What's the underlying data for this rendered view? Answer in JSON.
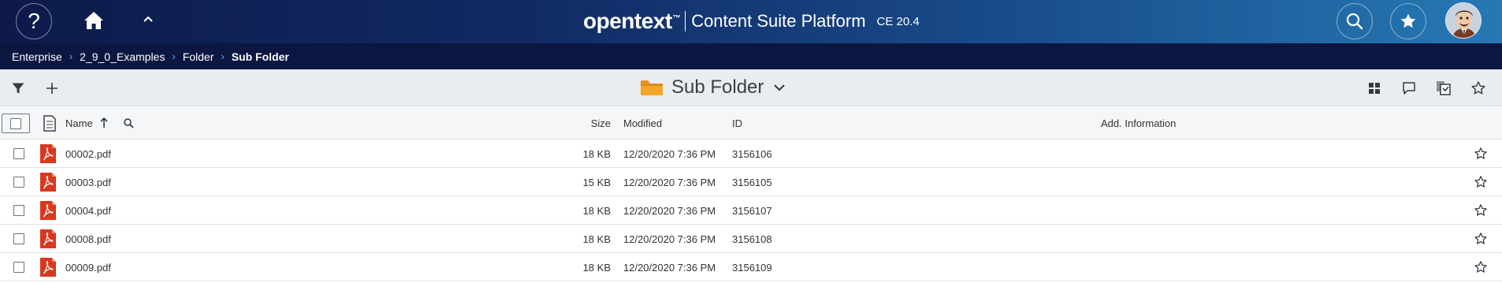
{
  "header": {
    "brand_logo": "opentext",
    "brand_tm": "™",
    "product_name": "Content Suite Platform",
    "version": "CE 20.4",
    "help_glyph": "?",
    "icons": [
      "help-icon",
      "home-icon",
      "caret-up-icon",
      "search-icon",
      "star-icon",
      "avatar"
    ]
  },
  "breadcrumb": {
    "items": [
      "Enterprise",
      "2_9_0_Examples",
      "Folder",
      "Sub Folder"
    ],
    "separator": "›"
  },
  "toolbar": {
    "title": "Sub Folder",
    "left_icons": [
      "filter-icon",
      "plus-icon"
    ],
    "right_icons": [
      "grid-view-icon",
      "comment-icon",
      "collection-icon",
      "star-icon"
    ]
  },
  "table": {
    "columns": {
      "name": "Name",
      "size": "Size",
      "modified": "Modified",
      "id": "ID",
      "info": "Add. Information"
    },
    "sort": "ascending",
    "rows": [
      {
        "name": "00002.pdf",
        "size": "18 KB",
        "modified": "12/20/2020 7:36 PM",
        "id": "3156106"
      },
      {
        "name": "00003.pdf",
        "size": "15 KB",
        "modified": "12/20/2020 7:36 PM",
        "id": "3156105"
      },
      {
        "name": "00004.pdf",
        "size": "18 KB",
        "modified": "12/20/2020 7:36 PM",
        "id": "3156107"
      },
      {
        "name": "00008.pdf",
        "size": "18 KB",
        "modified": "12/20/2020 7:36 PM",
        "id": "3156108"
      },
      {
        "name": "00009.pdf",
        "size": "18 KB",
        "modified": "12/20/2020 7:36 PM",
        "id": "3156109"
      }
    ]
  },
  "colors": {
    "header_dark": "#0d1a4a",
    "header_light": "#2679b4",
    "breadcrumb_bg": "#0b1741",
    "breadcrumb_sep": "#6fb1e8",
    "folder": "#e8931f",
    "pdf": "#d9381e"
  }
}
